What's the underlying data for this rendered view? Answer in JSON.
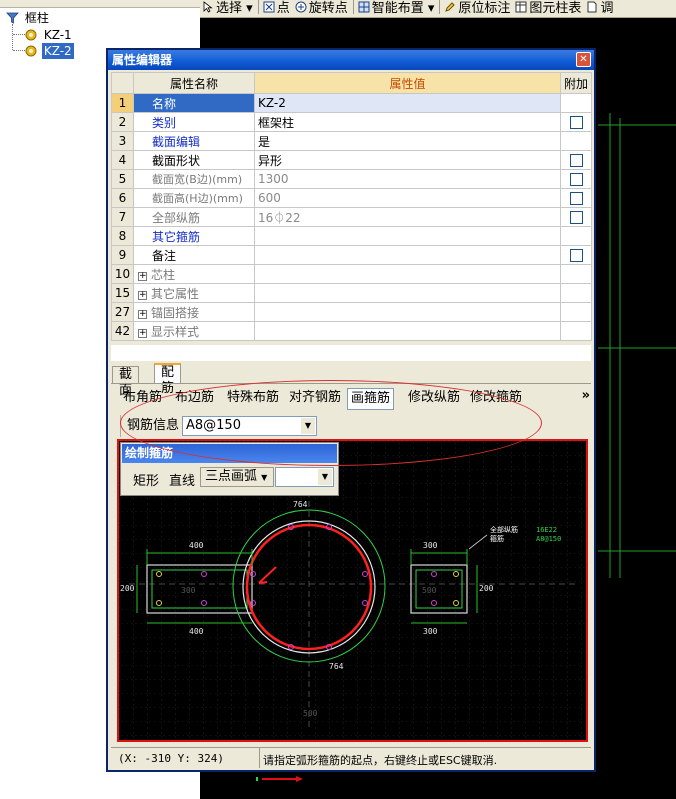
{
  "tree": {
    "root": "框柱",
    "items": [
      {
        "label": "KZ-1",
        "selected": false
      },
      {
        "label": "KZ-2",
        "selected": true
      }
    ]
  },
  "toolbar": {
    "items": [
      "选择",
      "点",
      "旋转点",
      "智能布置",
      "原位标注",
      "图元柱表",
      "调"
    ]
  },
  "dialog": {
    "title": "属性编辑器",
    "columns": {
      "name": "属性名称",
      "value": "属性值",
      "extra": "附加"
    },
    "rows": [
      {
        "num": "1",
        "name": "名称",
        "value": "KZ-2",
        "checkbox": false
      },
      {
        "num": "2",
        "name": "类别",
        "value": "框架柱",
        "checkbox": true
      },
      {
        "num": "3",
        "name": "截面编辑",
        "value": "是",
        "checkbox": false
      },
      {
        "num": "4",
        "name": "截面形状",
        "value": "异形",
        "checkbox": true
      },
      {
        "num": "5",
        "name": "截面宽(B边)(mm)",
        "value": "1300",
        "checkbox": true
      },
      {
        "num": "6",
        "name": "截面高(H边)(mm)",
        "value": "600",
        "checkbox": true
      },
      {
        "num": "7",
        "name": "全部纵筋",
        "value": "16⏀22",
        "checkbox": true
      },
      {
        "num": "8",
        "name": "其它箍筋",
        "value": "",
        "checkbox": false
      },
      {
        "num": "9",
        "name": "备注",
        "value": "",
        "checkbox": true
      },
      {
        "num": "10",
        "name": "芯柱",
        "value": "",
        "checkbox": false
      },
      {
        "num": "15",
        "name": "其它属性",
        "value": "",
        "checkbox": false
      },
      {
        "num": "27",
        "name": "锚固搭接",
        "value": "",
        "checkbox": false
      },
      {
        "num": "42",
        "name": "显示样式",
        "value": "",
        "checkbox": false
      }
    ],
    "tabs": [
      "截面",
      "配筋"
    ],
    "rebar_toolbar": [
      "布角筋",
      "布边筋",
      "特殊布筋",
      "对齐钢筋",
      "画箍筋",
      "修改纵筋",
      "修改箍筋"
    ],
    "rebar_info_label": "钢筋信息",
    "rebar_info_value": "A8@150",
    "palette": {
      "title": "绘制箍筋",
      "items": [
        "矩形",
        "直线"
      ],
      "mode": "三点画弧"
    },
    "drawing": {
      "dims": {
        "top_arc": "764",
        "bottom_arc": "764",
        "left_top": "400",
        "left_bottom": "400",
        "right_top": "300",
        "right_bottom": "300",
        "left_height": "200",
        "right_height": "200",
        "left_inner": "300",
        "right_inner": "500",
        "bottom_center": "500"
      },
      "legend_labels": [
        "全部纵筋",
        "箍筋"
      ],
      "legend_values": [
        "16E22",
        "A8@150"
      ]
    },
    "status": {
      "coords": "(X: -310 Y: 324)",
      "message": "请指定弧形箍筋的起点，右键终止或ESC键取消."
    }
  },
  "colors": {
    "title_blue": "#0f5bd6",
    "selection": "#316ac5",
    "header_value": "#f7e3a8",
    "canvas_border": "#e01010",
    "rebar_green": "#2fd24a",
    "stirrup_red": "#ff2020",
    "dim_green": "#28c028"
  }
}
